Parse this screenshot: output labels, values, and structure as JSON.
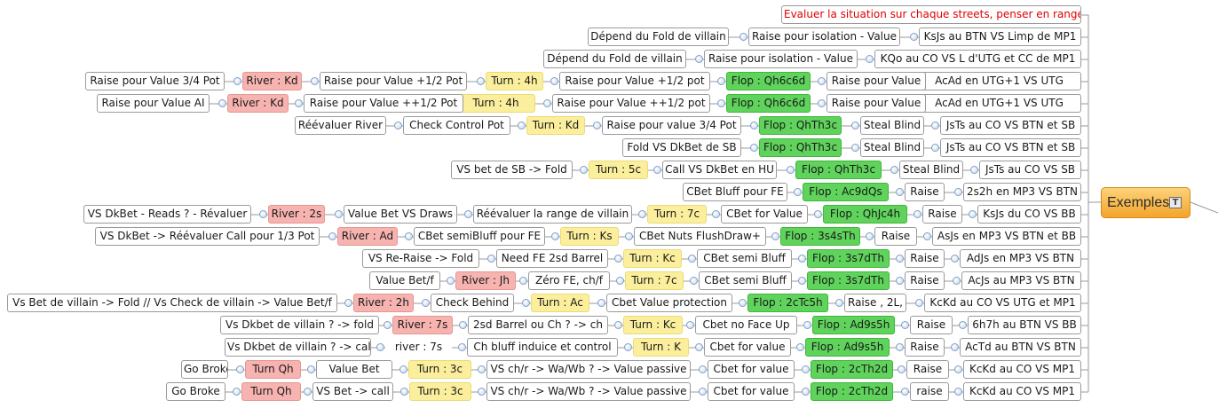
{
  "root": {
    "label": "Exemples",
    "icon": "note-icon"
  },
  "branches": [
    [
      "Evaluer la situation sur chaque streets, penser en range,"
    ],
    [
      "KsJs au BTN VS Limp de MP1",
      "Raise pour isolation - Value",
      "Dépend du Fold de villain"
    ],
    [
      "KQo au CO VS L d'UTG et CC de MP1",
      "Raise pour isolation - Value",
      "Dépend du Fold de villain"
    ],
    [
      "AcAd en UTG+1 VS UTG",
      "Raise pour Value",
      "Flop : Qh6c6d",
      "Raise pour Value +1/2 pot",
      "Turn : 4h",
      "Raise pour Value +1/2 Pot",
      "River : Kd",
      "Raise pour Value 3/4 Pot"
    ],
    [
      "AcAd en UTG+1 VS UTG",
      "Raise pour Value",
      "Flop : Qh6c6d",
      "Raise pour Value ++1/2 pot",
      "Turn : 4h",
      "Raise pour Value ++1/2 Pot",
      "River : Kd",
      "Raise pour Value AI"
    ],
    [
      "JsTs au CO VS BTN et SB",
      "Steal Blind",
      "Flop : QhTh3c",
      "Raise pour value 3/4 Pot",
      "Turn : Kd",
      "Check Control Pot",
      "Réévaluer River"
    ],
    [
      "JsTs au CO VS BTN et SB",
      "Steal Blind",
      "Flop : QhTh3c",
      "Fold VS DkBet de SB"
    ],
    [
      "JsTs au CO VS SB",
      "Steal Blind",
      "Flop : QhTh3c",
      "Call VS DkBet en HU",
      "Turn : 5c",
      "VS bet de SB -> Fold"
    ],
    [
      "2s2h en MP3 VS BTN",
      "Raise",
      "Flop : Ac9dQs",
      "CBet Bluff pour FE"
    ],
    [
      "KsJs du CO VS BB",
      "Raise",
      "Flop : QhJc4h",
      "CBet for Value",
      "Turn : 7c",
      "Réévaluer la range de villain",
      "Value Bet VS Draws",
      "River : 2s",
      "VS DkBet - Reads ? - Révaluer"
    ],
    [
      "AsJs en MP3 VS BTN et BB",
      "Raise",
      "Flop : 3s4sTh",
      "CBet Nuts FlushDraw+",
      "Turn : Ks",
      "CBet semiBluff pour FE",
      "River : Ad",
      "VS DkBet -> Réévaluer Call pour 1/3 Pot"
    ],
    [
      "AdJs en MP3 VS BTN",
      "Raise",
      "Flop : 3s7dTh",
      "CBet semi Bluff",
      "Turn : Kc",
      "Need FE 2sd Barrel",
      "VS Re-Raise -> Fold"
    ],
    [
      "AcJs au MP3 VS BTN",
      "Raise",
      "Flop : 3s7dTh",
      "CBet semi Bluff",
      "Turn : 7c",
      "Zéro FE, ch/f",
      "River : Jh",
      "Value Bet/f"
    ],
    [
      "KcKd au CO VS UTG et MP1",
      "Raise , 2L,",
      "Flop : 2cTc5h",
      "Cbet Value protection",
      "Turn : Ac",
      "Check Behind",
      "River : 2h",
      "Vs Bet de villain -> Fold  // Vs Check de villain -> Value Bet/f"
    ],
    [
      "6h7h au BTN VS BB",
      "Raise",
      "Flop : Ad9s5h",
      "Cbet no Face Up",
      "Turn : Kc",
      "2sd Barrel ou Ch ? -> ch",
      "River : 7s",
      "Vs Dkbet de villain ? -> fold"
    ],
    [
      "AcTd au BTN VS BTN",
      "Raise",
      "Flop : Ad9s5h",
      "Cbet for value",
      "Turn : K",
      "Ch bluff induice et control",
      "river : 7s",
      "Vs Dkbet de villain ? -> call"
    ],
    [
      "KcKd au CO VS MP1",
      "Raise",
      "Flop : 2cTh2d",
      "Cbet for value",
      "VS ch/r -> Wa/Wb ? -> Value passive",
      "Turn : 3c",
      "Value Bet",
      "Turn Qh",
      "Go Broke"
    ],
    [
      "KcKd au CO VS MP1",
      "raise",
      "Flop : 2cTh2d",
      "Cbet for value",
      "VS ch/r -> Wa/Wb ? -> Value passive",
      "Turn : 3c",
      "VS Bet -> call",
      "Turn Qh",
      "Go Broke"
    ]
  ],
  "colors": {
    "river": "#f6b3b0",
    "turn": "#fbef9d",
    "flop": "#5fd35c",
    "root": "#f3a52c",
    "connector": "#9a9a9a",
    "warning_text": "#e00000"
  }
}
